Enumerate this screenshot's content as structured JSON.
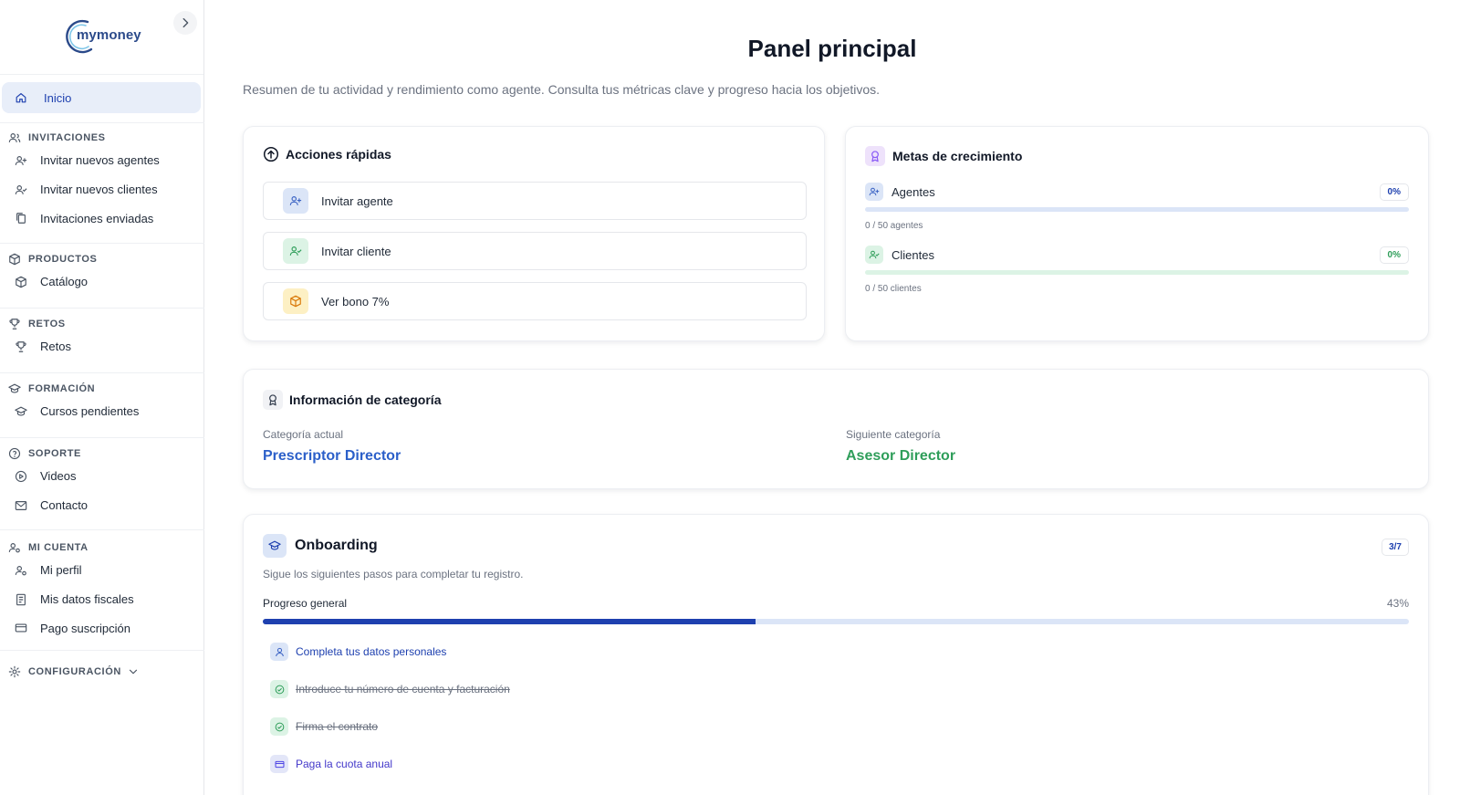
{
  "sidebar": {
    "logo": "mymoney",
    "active_item": "Inicio",
    "sections": [
      {
        "title": "INVITACIONES",
        "items": [
          "Invitar nuevos agentes",
          "Invitar nuevos clientes",
          "Invitaciones enviadas"
        ]
      },
      {
        "title": "PRODUCTOS",
        "items": [
          "Catálogo"
        ]
      },
      {
        "title": "RETOS",
        "items": [
          "Retos"
        ]
      },
      {
        "title": "FORMACIÓN",
        "items": [
          "Cursos pendientes"
        ]
      },
      {
        "title": "SOPORTE",
        "items": [
          "Videos",
          "Contacto"
        ]
      },
      {
        "title": "MI CUENTA",
        "items": [
          "Mi perfil",
          "Mis datos fiscales",
          "Pago suscripción"
        ]
      },
      {
        "title": "CONFIGURACIÓN",
        "items": []
      }
    ]
  },
  "header": {
    "title": "Panel principal",
    "subtitle": "Resumen de tu actividad y rendimiento como agente. Consulta tus métricas clave y progreso hacia los objetivos."
  },
  "quick_actions": {
    "title": "Acciones rápidas",
    "items": [
      "Invitar agente",
      "Invitar cliente",
      "Ver bono 7%"
    ]
  },
  "goals": {
    "title": "Metas de crecimiento",
    "items": [
      {
        "label": "Agentes",
        "percent_label": "0%",
        "progress": 0,
        "caption": "0 / 50 agentes"
      },
      {
        "label": "Clientes",
        "percent_label": "0%",
        "progress": 0,
        "caption": "0 / 50 clientes"
      }
    ]
  },
  "category": {
    "title": "Información de categoría",
    "current_label": "Categoría actual",
    "current_value": "Prescriptor Director",
    "next_label": "Siguiente categoría",
    "next_value": "Asesor Director"
  },
  "onboarding": {
    "title": "Onboarding",
    "badge": "3/7",
    "subtitle": "Sigue los siguientes pasos para completar tu registro.",
    "progress_label": "Progreso general",
    "progress_percent_label": "43%",
    "progress": 0.43,
    "steps": [
      {
        "label": "Completa tus datos personales",
        "done": false
      },
      {
        "label": "Introduce tu número de cuenta y facturación",
        "done": true
      },
      {
        "label": "Firma el contrato",
        "done": true
      },
      {
        "label": "Paga la cuota anual",
        "done": false
      }
    ]
  },
  "colors": {
    "brand": "#1e40af",
    "accent_green": "#2f9e5a",
    "progress_track": "#dbe5f7",
    "clients_track": "#dcf3e5"
  }
}
